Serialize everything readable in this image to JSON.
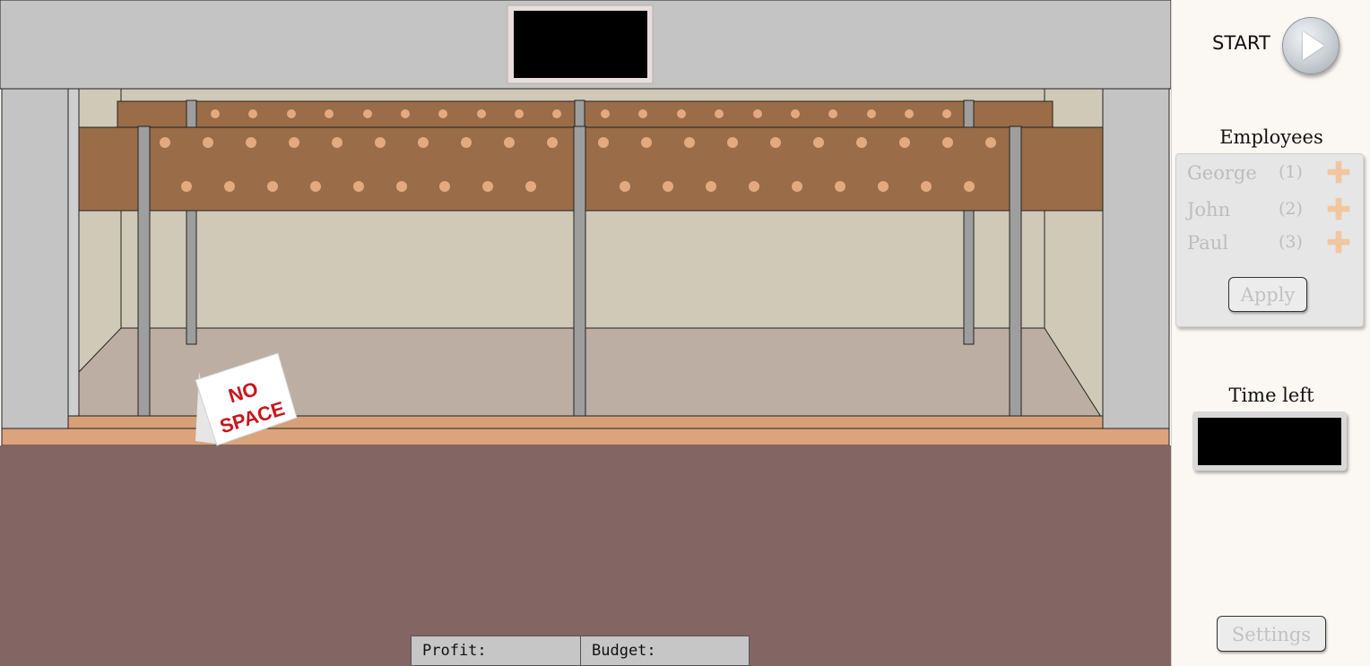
{
  "scene": {
    "sign": {
      "line1": "NO",
      "line2": "SPACE"
    },
    "colors": {
      "ceiling": "#c4c4c4",
      "back_wall": "#d0c9b8",
      "floor": "#bcaea2",
      "shelf_wood": "#9a6c47",
      "peg": "#e3aa80",
      "counter": "#d6a078",
      "shop_floor": "#836564",
      "post": "#9e9e9e"
    }
  },
  "stats": {
    "profit_label": "Profit:",
    "budget_label": "Budget:"
  },
  "panel": {
    "start_label": "START",
    "employees_title": "Employees",
    "employees": [
      {
        "name": "George",
        "count": "(1)"
      },
      {
        "name": "John",
        "count": "(2)"
      },
      {
        "name": "Paul",
        "count": "(3)"
      }
    ],
    "apply_label": "Apply",
    "time_left_title": "Time left",
    "settings_label": "Settings"
  }
}
